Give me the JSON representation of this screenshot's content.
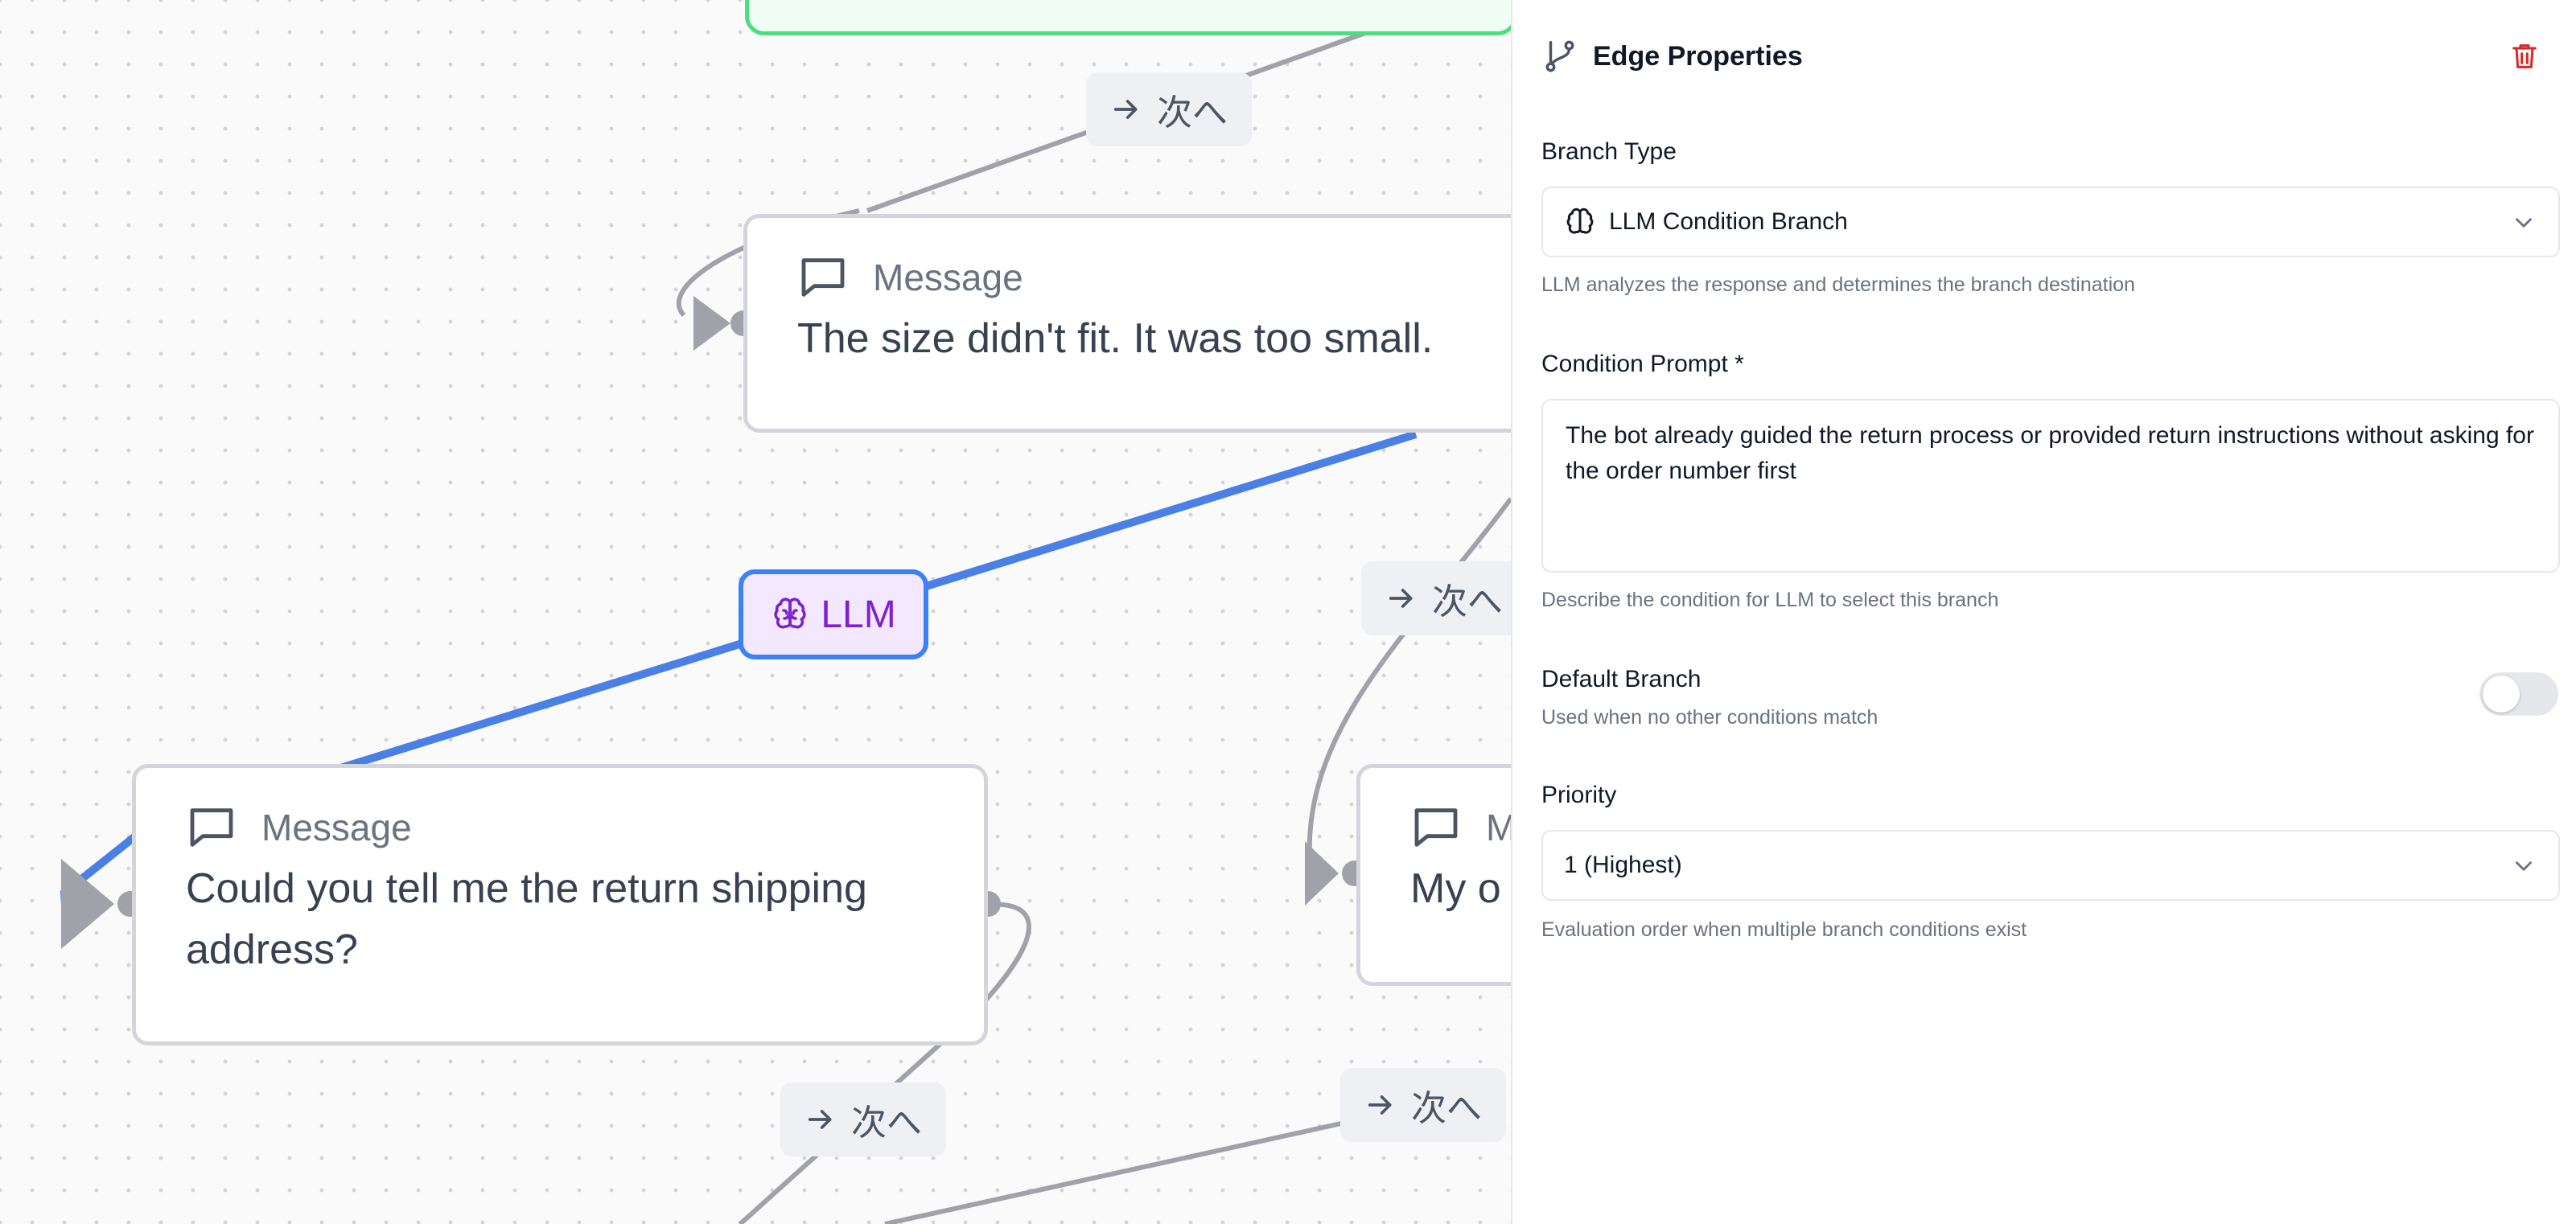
{
  "canvas": {
    "nodes": [
      {
        "title": "Message",
        "text": "The size didn't fit. It was too small."
      },
      {
        "title": "Message",
        "text_line1": "Could you tell me the return shipping",
        "text_line2": "address?"
      },
      {
        "title": "M",
        "text": "My o"
      }
    ],
    "edge_labels": {
      "next": "次へ",
      "llm": "LLM"
    },
    "colors": {
      "selected_edge": "#4a7fe6",
      "edge": "#a1a1aa",
      "llm_chip_bg": "#f3e8ff",
      "llm_chip_text": "#7e22ce",
      "start_node_border": "#4ade80"
    }
  },
  "panel": {
    "title": "Edge Properties",
    "icons": {
      "header": "git-branch-icon",
      "delete": "trash-icon"
    },
    "branch_type": {
      "label": "Branch Type",
      "value": "LLM Condition Branch",
      "help": "LLM analyzes the response and determines the branch destination"
    },
    "condition_prompt": {
      "label": "Condition Prompt *",
      "value": "The bot already guided the return process or provided return instructions without asking for the order number first",
      "help": "Describe the condition for LLM to select this branch"
    },
    "default_branch": {
      "label": "Default Branch",
      "help": "Used when no other conditions match",
      "enabled": false
    },
    "priority": {
      "label": "Priority",
      "value": "1 (Highest)",
      "help": "Evaluation order when multiple branch conditions exist"
    }
  }
}
